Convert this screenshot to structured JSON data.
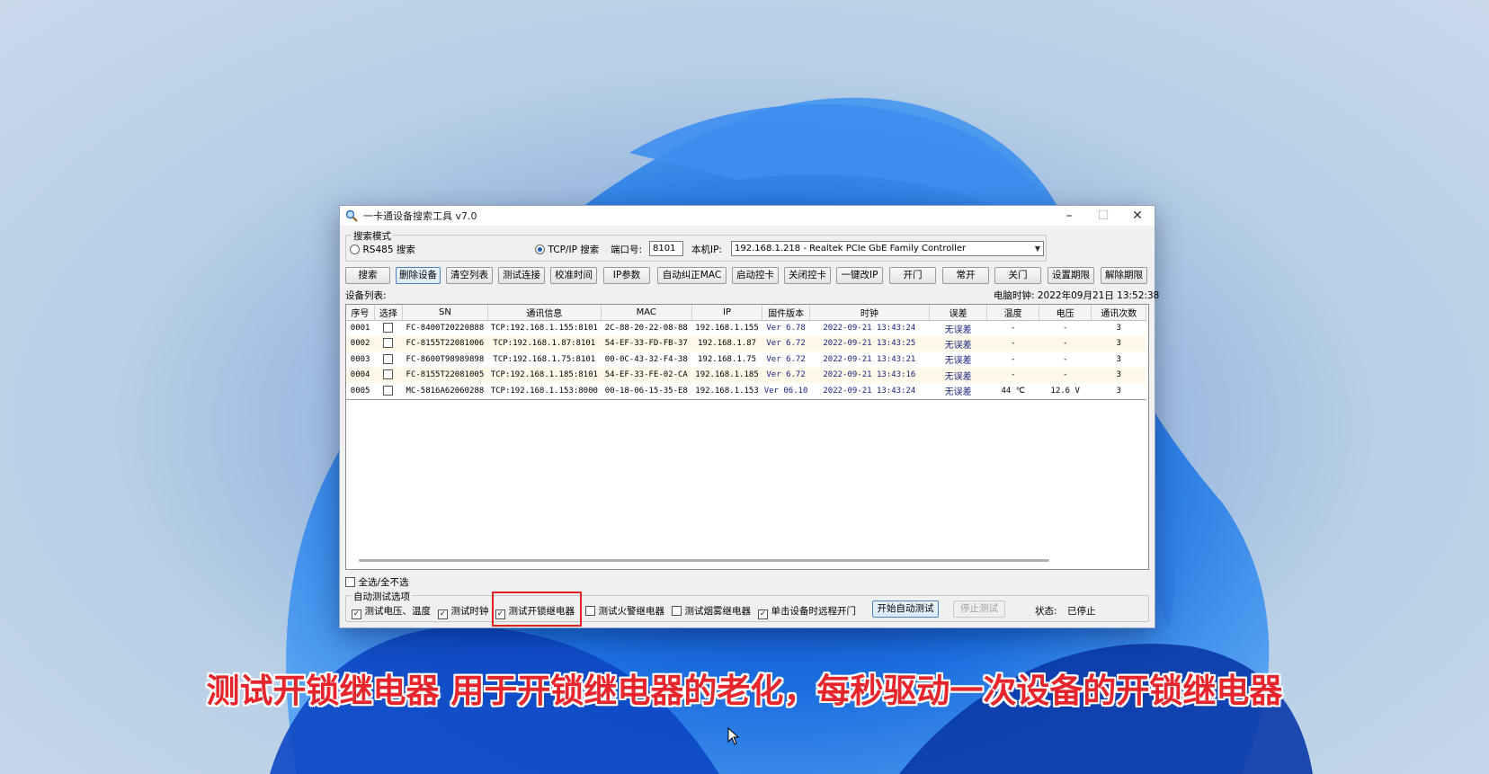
{
  "window": {
    "title": "一卡通设备搜索工具 v7.0"
  },
  "search_mode": {
    "legend": "搜索模式",
    "rs485_label": "RS485 搜索",
    "tcpip_label": "TCP/IP 搜索",
    "port_label": "端口号:",
    "port_value": "8101",
    "local_ip_label": "本机IP:",
    "local_ip_value": "192.168.1.218 - Realtek PCIe GbE Family Controller"
  },
  "toolbar": {
    "buttons": [
      "搜索",
      "删除设备",
      "清空列表",
      "测试连接",
      "校准时间",
      "IP参数",
      "自动纠正MAC",
      "启动控卡",
      "关闭控卡",
      "一键改IP",
      "开门",
      "常开",
      "关门",
      "设置期限",
      "解除期限"
    ]
  },
  "device_list_label": "设备列表:",
  "pc_time": "电脑时钟: 2022年09月21日 13:52:38",
  "table": {
    "headers": [
      "序号",
      "选择",
      "SN",
      "通讯信息",
      "MAC",
      "IP",
      "固件版本",
      "时钟",
      "误差",
      "温度",
      "电压",
      "通讯次数"
    ],
    "rows": [
      [
        "0001",
        "",
        "FC-8400T20220888",
        "TCP:192.168.1.155:8101",
        "2C-88-20-22-08-88",
        "192.168.1.155",
        "Ver  6.78",
        "2022-09-21 13:43:24",
        "无误差",
        "-",
        "-",
        "3"
      ],
      [
        "0002",
        "",
        "FC-8155T22081006",
        "TCP:192.168.1.87:8101",
        "54-EF-33-FD-FB-37",
        "192.168.1.87",
        "Ver  6.72",
        "2022-09-21 13:43:25",
        "无误差",
        "-",
        "-",
        "3"
      ],
      [
        "0003",
        "",
        "FC-8600T98989898",
        "TCP:192.168.1.75:8101",
        "00-0C-43-32-F4-38",
        "192.168.1.75",
        "Ver  6.72",
        "2022-09-21 13:43:21",
        "无误差",
        "-",
        "-",
        "3"
      ],
      [
        "0004",
        "",
        "FC-8155T22081005",
        "TCP:192.168.1.185:8101",
        "54-EF-33-FE-02-CA",
        "192.168.1.185",
        "Ver  6.72",
        "2022-09-21 13:43:16",
        "无误差",
        "-",
        "-",
        "3"
      ],
      [
        "0005",
        "",
        "MC-5816A62060288",
        "TCP:192.168.1.153:8000",
        "00-18-06-15-35-E8",
        "192.168.1.153",
        "Ver 06.10",
        "2022-09-21 13:43:24",
        "无误差",
        "44 ℃",
        "12.6 V",
        "3"
      ]
    ]
  },
  "select_all_label": "全选/全不选",
  "auto_test": {
    "legend": "自动测试选项",
    "opt_voltage": "测试电压、温度",
    "opt_clock": "测试时钟",
    "opt_unlock_relay": "测试开锁继电器",
    "opt_fire_relay": "测试火警继电器",
    "opt_smoke_relay": "测试烟雾继电器",
    "opt_remote_open": "单击设备时远程开门",
    "start_label": "开始自动测试",
    "stop_label": "停止测试",
    "status_label": "状态:",
    "status_value": "已停止"
  },
  "caption": "测试开锁继电器 用于开锁继电器的老化，每秒驱动一次设备的开锁继电器",
  "colors": {
    "caption": "#e5242b",
    "highlight": "#e12020",
    "link_blue": "#1a237e"
  }
}
